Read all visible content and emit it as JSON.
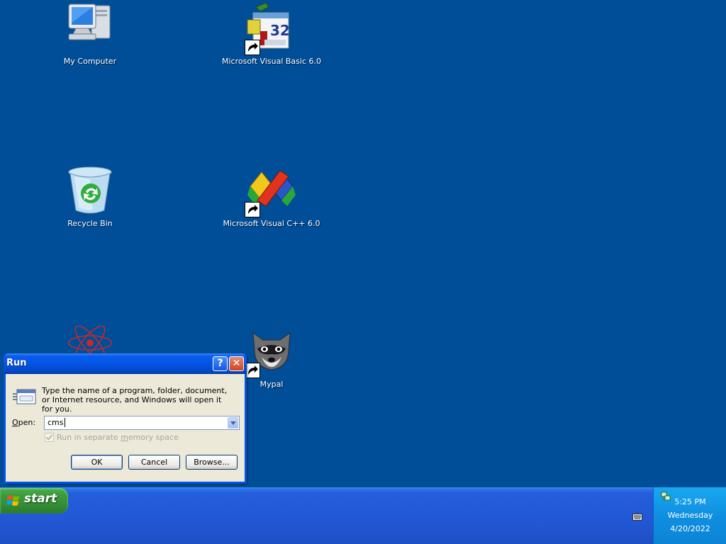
{
  "desktop": {
    "icons": [
      {
        "label": "My Computer",
        "icon": "my-computer-icon"
      },
      {
        "label": "Microsoft Visual Basic 6.0",
        "icon": "visual-basic-icon"
      },
      {
        "label": "Recycle Bin",
        "icon": "recycle-bin-icon"
      },
      {
        "label": "Microsoft Visual C++ 6.0",
        "icon": "visual-cpp-icon"
      },
      {
        "label": "Mypal",
        "icon": "mypal-icon"
      }
    ]
  },
  "run_dialog": {
    "title": "Run",
    "prompt": "Type the name of a program, folder, document, or Internet resource, and Windows will open it for you.",
    "open_label_pre": "",
    "open_label_key": "O",
    "open_label_post": "pen:",
    "open_value": "cms",
    "checkbox_label_pre": "Run in separate ",
    "checkbox_label_key": "m",
    "checkbox_label_post": "emory space",
    "ok_label": "OK",
    "cancel_label": "Cancel",
    "browse_label": "Browse...",
    "help_symbol": "?",
    "close_symbol": "✕"
  },
  "taskbar": {
    "start_label": "start",
    "clock_time": "5:25 PM",
    "clock_day": "Wednesday",
    "clock_date": "4/20/2022"
  },
  "colors": {
    "desktop_bg": "#004e98",
    "taskbar_blue": "#245edb",
    "start_green": "#3c9a3d",
    "dialog_face": "#ece9d8"
  }
}
